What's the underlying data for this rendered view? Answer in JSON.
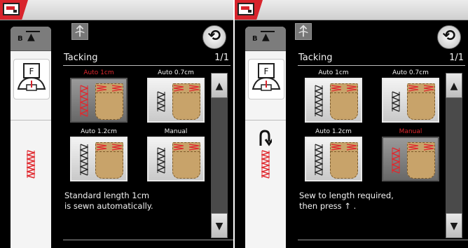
{
  "screens": [
    {
      "title": "Tacking",
      "page": "1/1",
      "options": [
        {
          "label": "Auto 1cm",
          "selected": true
        },
        {
          "label": "Auto 0.7cm",
          "selected": false
        },
        {
          "label": "Auto 1.2cm",
          "selected": false
        },
        {
          "label": "Manual",
          "selected": false
        }
      ],
      "message": "Standard length 1cm\nis sewn automatically."
    },
    {
      "title": "Tacking",
      "page": "1/1",
      "options": [
        {
          "label": "Auto 1cm",
          "selected": false
        },
        {
          "label": "Auto 0.7cm",
          "selected": false
        },
        {
          "label": "Auto 1.2cm",
          "selected": false
        },
        {
          "label": "Manual",
          "selected": true
        }
      ],
      "message": "Sew to length required,\nthen press ↑ ."
    }
  ],
  "sidebar": {
    "presser_letter": "B",
    "foot_letter": "F"
  },
  "icons": {
    "reverse": "reverse-sewing-icon",
    "back": "back-arrow-icon",
    "foot": "presser-foot-icon",
    "stitch": "stitch-icon"
  },
  "colors": {
    "accent": "#e0282e",
    "background": "#000000",
    "panel": "#f4f4f4"
  }
}
